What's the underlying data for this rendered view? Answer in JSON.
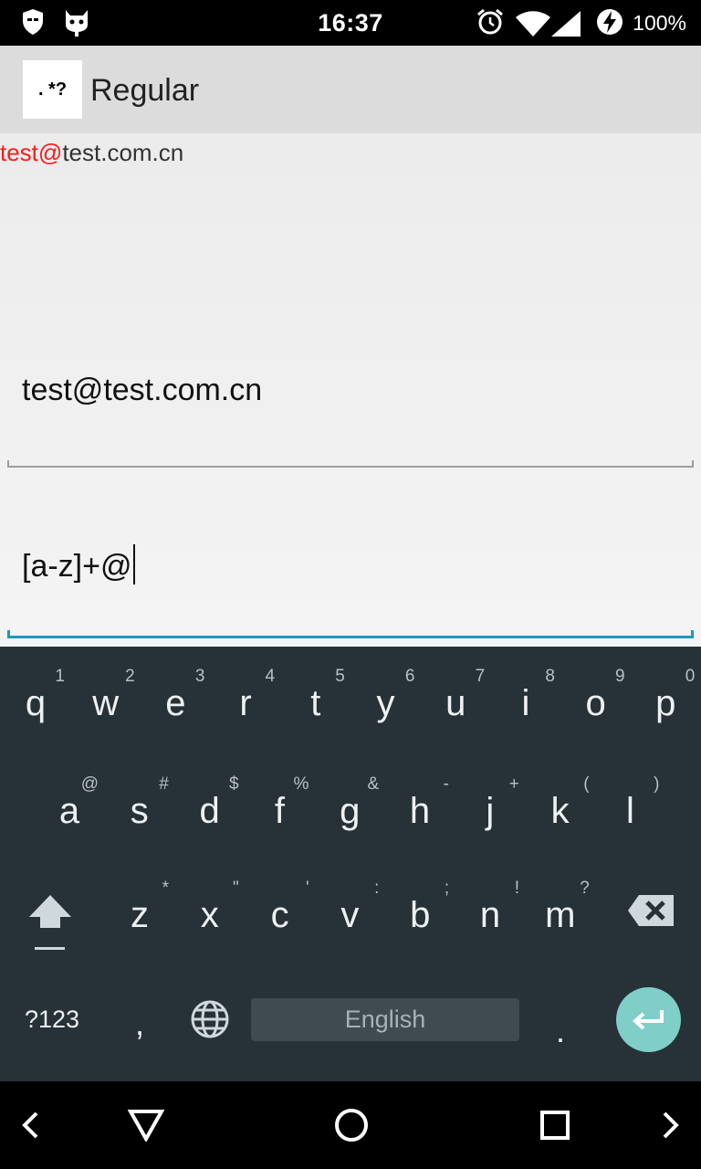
{
  "status_bar": {
    "time": "16:37",
    "battery": "100%",
    "icons": [
      "shield-icon",
      "bot-icon",
      "alarm-icon",
      "wifi-icon",
      "signal-icon",
      "charging-icon"
    ]
  },
  "app_bar": {
    "logo_text": ". *?",
    "title": "Regular"
  },
  "content": {
    "match_result": {
      "matched": "test@",
      "rest": "test.com.cn"
    },
    "text_field": {
      "value": "test@test.com.cn"
    },
    "regex_field": {
      "value": "[a-z]+@"
    }
  },
  "keyboard": {
    "row1": [
      {
        "k": "q",
        "h": "1"
      },
      {
        "k": "w",
        "h": "2"
      },
      {
        "k": "e",
        "h": "3"
      },
      {
        "k": "r",
        "h": "4"
      },
      {
        "k": "t",
        "h": "5"
      },
      {
        "k": "y",
        "h": "6"
      },
      {
        "k": "u",
        "h": "7"
      },
      {
        "k": "i",
        "h": "8"
      },
      {
        "k": "o",
        "h": "9"
      },
      {
        "k": "p",
        "h": "0"
      }
    ],
    "row2": [
      {
        "k": "a",
        "h": "@"
      },
      {
        "k": "s",
        "h": "#"
      },
      {
        "k": "d",
        "h": "$"
      },
      {
        "k": "f",
        "h": "%"
      },
      {
        "k": "g",
        "h": "&"
      },
      {
        "k": "h",
        "h": "-"
      },
      {
        "k": "j",
        "h": "+"
      },
      {
        "k": "k",
        "h": "("
      },
      {
        "k": "l",
        "h": ")"
      }
    ],
    "row3": [
      {
        "k": "z",
        "h": "*"
      },
      {
        "k": "x",
        "h": "\""
      },
      {
        "k": "c",
        "h": "'"
      },
      {
        "k": "v",
        "h": ":"
      },
      {
        "k": "b",
        "h": ";"
      },
      {
        "k": "n",
        "h": "!"
      },
      {
        "k": "m",
        "h": "?"
      }
    ],
    "symbols_label": "?123",
    "comma": ",",
    "space_label": "English",
    "period": ".",
    "colors": {
      "background": "#263238",
      "enter": "#7fcfc8",
      "active_underline": "#1f97c0"
    }
  },
  "nav_bar": {
    "icons": [
      "back-chevron-icon",
      "back-triangle-icon",
      "home-circle-icon",
      "recents-square-icon",
      "forward-chevron-icon"
    ]
  }
}
